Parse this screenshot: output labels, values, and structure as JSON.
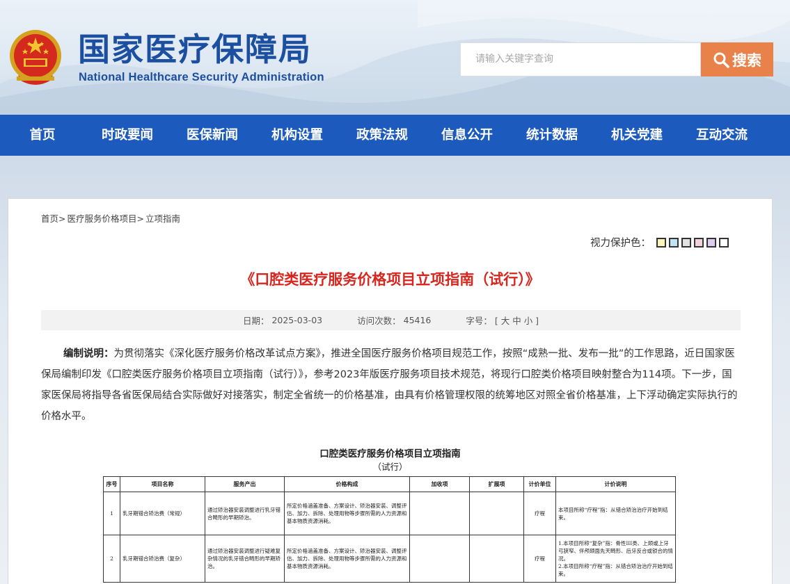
{
  "header": {
    "logo_cn": "国家医疗保障局",
    "logo_en": "National Healthcare Security Administration",
    "search_placeholder": "请输入关键字查询",
    "search_button": "搜索"
  },
  "nav": [
    "首页",
    "时政要闻",
    "医保新闻",
    "机构设置",
    "政策法规",
    "信息公开",
    "统计数据",
    "机关党建",
    "互动交流"
  ],
  "breadcrumb": [
    "首页>",
    "医疗服务价格项目>",
    "立项指南"
  ],
  "eye_protect": {
    "label": "视力保护色：",
    "colors": [
      "#fdf4b8",
      "#bfe3f3",
      "#e2e2e2",
      "#f4d0dc",
      "#dcccef",
      "#ffffff"
    ]
  },
  "article": {
    "title": "《口腔类医疗服务价格项目立项指南（试行）》",
    "date_label": "日期：",
    "date": "2025-03-03",
    "visits_label": "访问次数：",
    "visits": "45416",
    "font_label": "字号：",
    "font_options": "[ 大 中 小 ]",
    "intro_bold": "编制说明：",
    "intro_text": "为贯彻落实《深化医疗服务价格改革试点方案》，推进全国医疗服务价格项目规范工作，按照“成熟一批、发布一批”的工作思路，近日国家医保局编制印发《口腔类医疗服务价格项目立项指南（试行）》，参考2023年版医疗服务项目技术规范，将现行口腔类价格项目映射整合为114项。下一步，国家医保局将指导各省医保局结合实际做好对接落实，制定全省统一的价格基准，由具有价格管理权限的统筹地区对照全省价格基准，上下浮动确定实际执行的价格水平。"
  },
  "document": {
    "title": "口腔类医疗服务价格项目立项指南",
    "subtitle": "（试行）",
    "headers": [
      "序号",
      "项目名称",
      "服务产出",
      "价格构成",
      "加收项",
      "扩展项",
      "计价单位",
      "计价说明"
    ],
    "rows": [
      {
        "no": "1",
        "name": "乳牙期错合矫治费（常规）",
        "output": "通过矫治器安装调整进行乳牙错合畸形的早期矫治。",
        "composition": "所定价格涵盖准备、方案设计、矫治器安装、调整评估、加力、拆除、处理用物等步骤所需的人力资源和基本物质资源消耗。",
        "addon": "",
        "extension": "",
        "unit": "疗程",
        "note": "本项目所称“疗程”指：从错合矫治治疗开始到结束。"
      },
      {
        "no": "2",
        "name": "乳牙期错合矫治费（复杂）",
        "output": "通过矫治器安装调整进行疑难复杂情况的乳牙错合畸形的早期矫治。",
        "composition": "所定价格涵盖准备、方案设计、矫治器安装、调整评估、加力、拆除、处理用物等步骤所需的人力资源和基本物质资源消耗。",
        "addon": "",
        "extension": "",
        "unit": "疗程",
        "note": "1.本项目所称“复杂”指：骨性III类、上颌或上牙弓狭窄、伴颅颌面先天畸形、后牙反合或锁合的情况。\n2.本项目所称“疗程”指：从错合矫治治疗开始到结束。"
      }
    ]
  }
}
